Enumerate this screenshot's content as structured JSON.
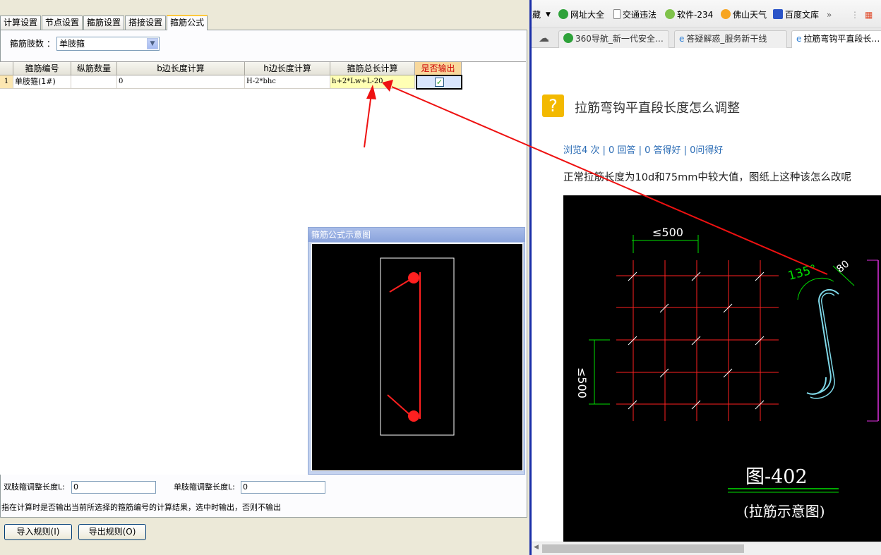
{
  "left": {
    "tabs": [
      "计算设置",
      "节点设置",
      "箍筋设置",
      "搭接设置",
      "箍筋公式"
    ],
    "active_tab": "箍筋公式",
    "limb_label": "箍筋肢数 ：",
    "limb_value": "单肢箍",
    "table": {
      "headers": [
        "",
        "箍筋编号",
        "纵筋数量",
        "b边长度计算",
        "h边长度计算",
        "箍筋总长计算",
        "是否输出"
      ],
      "rows": [
        {
          "index": "1",
          "name": "单肢箍(1#)",
          "count": "",
          "b_calc": "0",
          "h_calc": "H-2*bhc",
          "total_calc": "h+2*Lw+L-20",
          "output": true
        }
      ]
    },
    "diagram_title": "箍筋公式示意图",
    "double_label": "双肢箍调整长度L:",
    "double_value": "0",
    "single_label": "单肢箍调整长度L:",
    "single_value": "0",
    "hint": "指在计算时是否输出当前所选择的箍筋编号的计算结果，选中时输出，否则不输出",
    "import_btn": "导入规则(I)",
    "export_btn": "导出规则(O)"
  },
  "browser": {
    "fav_partial": "藏",
    "favorites": [
      "网址大全",
      "交通违法",
      "软件-234",
      "佛山天气",
      "百度文库"
    ],
    "more": "»",
    "tabs": [
      "360导航_新一代安全…",
      "答疑解惑_服务新干线",
      "拉筋弯钩平直段长…"
    ],
    "question_title": "拉筋弯钩平直段长度怎么调整",
    "stats": "浏览4 次 | 0 回答 | 0 答得好 | 0问得好",
    "question_text": "正常拉筋长度为10d和75mm中较大值，图纸上这种该怎么改呢",
    "cad": {
      "dim_top": "≤500",
      "dim_left": "≤500",
      "angle": "135°",
      "hook": "80",
      "fig_title": "图-402",
      "fig_subtitle": "(拉筋示意图)"
    }
  },
  "colors": {
    "annotation": "#ee1111",
    "cad_red": "#ff2020",
    "cad_green": "#00e000",
    "cad_cyan": "#7fd8e8"
  }
}
